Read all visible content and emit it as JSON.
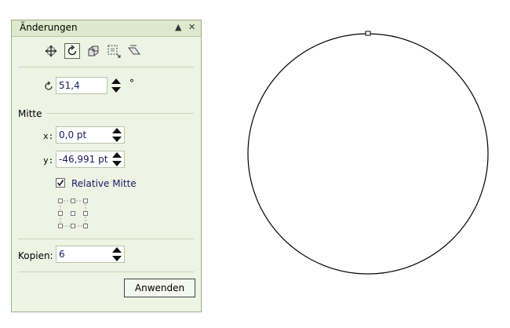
{
  "panel": {
    "title": "Änderungen",
    "rotation_value": "51,4",
    "degree_symbol": "°",
    "section_center": "Mitte",
    "x_label": "x:",
    "x_value": "0,0 pt",
    "y_label": "y:",
    "y_value": "-46,991 pt",
    "relative_center_label": "Relative Mitte",
    "relative_center_checked": true,
    "copies_label": "Kopien:",
    "copies_value": "6",
    "apply_label": "Anwenden"
  },
  "toolbar": {
    "tools": [
      "position-tool-icon",
      "rotate-tool-icon",
      "scale-tool-icon",
      "size-tool-icon",
      "skew-tool-icon"
    ],
    "active_tool": "rotate-tool-icon"
  },
  "colors": {
    "panel_bg": "#eef3e4",
    "titlebar_bg": "#dde8cc",
    "value_text": "#1a1a60"
  }
}
